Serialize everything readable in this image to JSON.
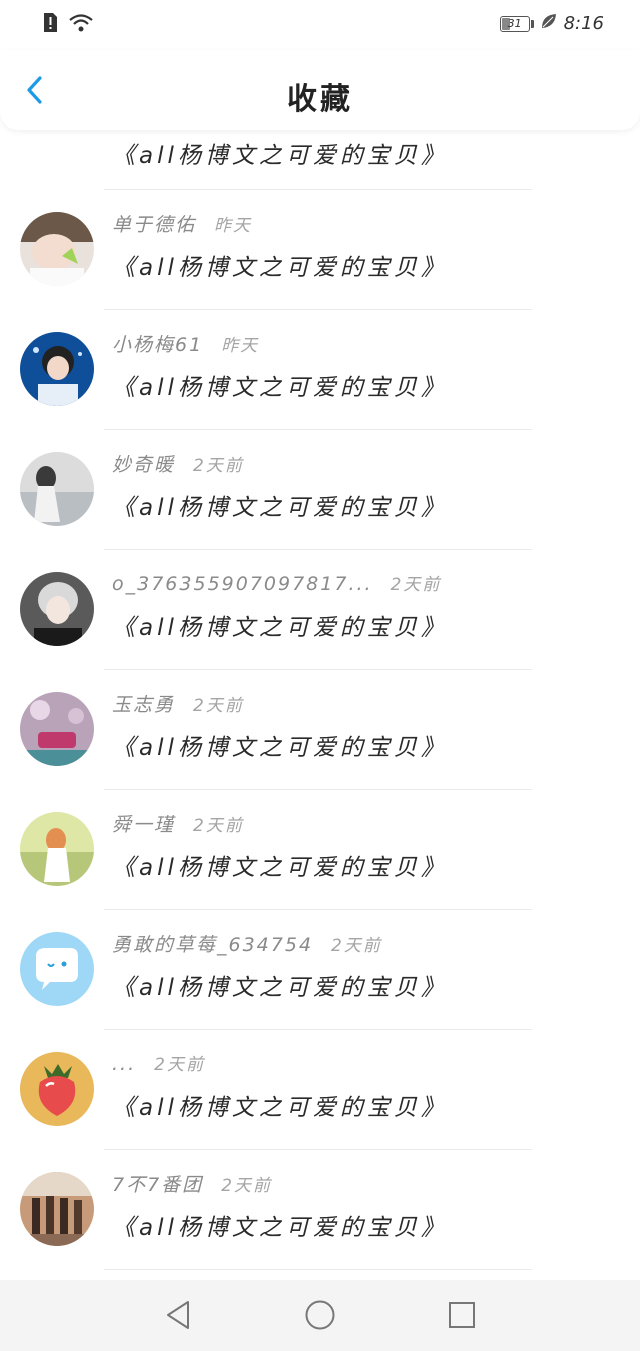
{
  "status_bar": {
    "time": "8:16",
    "battery": "31",
    "icons": [
      "alert-icon",
      "wifi-icon",
      "battery-icon",
      "leaf-icon"
    ]
  },
  "header": {
    "back_icon": "chevron-left-icon",
    "title": "收藏",
    "accent_color": "#1e9ae6"
  },
  "list": {
    "partial_row": {
      "title": "《all杨博文之可爱的宝贝》"
    },
    "items": [
      {
        "name": "单于德佑",
        "time": "昨天",
        "title": "《all杨博文之可爱的宝贝》",
        "avatar": "photo-avatar"
      },
      {
        "name": "小杨梅61",
        "time": "昨天",
        "title": "《all杨博文之可爱的宝贝》",
        "avatar": "photo-avatar"
      },
      {
        "name": "妙奇暖",
        "time": "2天前",
        "title": "《all杨博文之可爱的宝贝》",
        "avatar": "photo-avatar"
      },
      {
        "name": "o_37635590709781​7...",
        "time": "2天前",
        "title": "《all杨博文之可爱的宝贝》",
        "avatar": "photo-avatar"
      },
      {
        "name": "玉志勇",
        "time": "2天前",
        "title": "《all杨博文之可爱的宝贝》",
        "avatar": "photo-avatar"
      },
      {
        "name": "舜一瑾",
        "time": "2天前",
        "title": "《all杨博文之可爱的宝贝》",
        "avatar": "photo-avatar"
      },
      {
        "name": "勇敢的草莓_634754",
        "time": "2天前",
        "title": "《all杨博文之可爱的宝贝》",
        "avatar": "chat-bubble-avatar"
      },
      {
        "name": "...",
        "time": "2天前",
        "title": "《all杨博文之可爱的宝贝》",
        "avatar": "strawberry-avatar"
      },
      {
        "name": "7不7番团",
        "time": "2天前",
        "title": "《all杨博文之可爱的宝贝》",
        "avatar": "photo-avatar"
      }
    ]
  },
  "nav_bar": {
    "icons": [
      "back-triangle-icon",
      "home-circle-icon",
      "recents-square-icon"
    ]
  }
}
